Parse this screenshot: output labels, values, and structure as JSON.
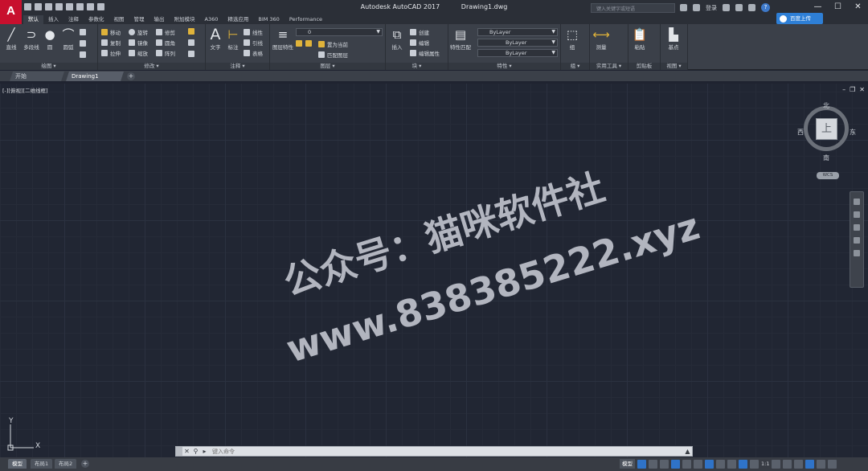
{
  "window": {
    "app_letter": "A",
    "title_app": "Autodesk AutoCAD 2017",
    "title_file": "Drawing1.dwg",
    "search_placeholder": "键入关键字或短语",
    "sign_in": "登录",
    "minimize": "—",
    "maximize": "☐",
    "close": "✕"
  },
  "cloud_button": "百度上传",
  "ribbon_tabs": [
    "默认",
    "插入",
    "注释",
    "参数化",
    "视图",
    "管理",
    "输出",
    "附加模块",
    "A360",
    "精选应用",
    "BIM 360",
    "Performance"
  ],
  "panels": {
    "draw": {
      "title": "绘图 ▾",
      "line": "直线",
      "polyline": "多段线",
      "circle": "圆",
      "arc": "圆弧"
    },
    "modify": {
      "title": "修改 ▾",
      "move": "移动",
      "rotate": "旋转",
      "trim": "修剪",
      "copy": "复制",
      "mirror": "镜像",
      "fillet": "圆角",
      "stretch": "拉伸",
      "scale": "缩放",
      "array": "阵列"
    },
    "annotation": {
      "title": "注释 ▾",
      "text": "文字",
      "dimension": "标注",
      "linear": "线性",
      "leader": "引线",
      "table": "表格"
    },
    "layers": {
      "title": "图层 ▾",
      "layer_props": "图层特性",
      "current_layer": "0",
      "make_current": "置为当前",
      "match_layer": "匹配图层"
    },
    "block": {
      "title": "块 ▾",
      "insert": "插入",
      "create": "创建",
      "edit": "编辑",
      "edit_attr": "编辑属性"
    },
    "properties": {
      "title": "特性 ▾",
      "match": "特性匹配",
      "color": "ByLayer",
      "linetype": "ByLayer",
      "lineweight": "ByLayer"
    },
    "groups": {
      "title": "组 ▾",
      "group": "组"
    },
    "utilities": {
      "title": "实用工具 ▾",
      "measure": "测量"
    },
    "clipboard": {
      "title": "剪贴板",
      "paste": "粘贴"
    },
    "view": {
      "title": "视图 ▾",
      "base": "基点"
    }
  },
  "file_tabs": [
    "开始",
    "Drawing1"
  ],
  "viewport": {
    "label": "[-][俯视][二维线框]",
    "minimize": "–",
    "restore": "❐",
    "close": "✕"
  },
  "viewcube": {
    "north": "北",
    "south": "南",
    "east": "东",
    "west": "西",
    "face": "上",
    "wcs": "WCS"
  },
  "ucs": {
    "x": "X",
    "y": "Y"
  },
  "watermark": {
    "line1": "公众号：猫咪软件社",
    "line2": "www.838385222.xyz"
  },
  "command_line": {
    "placeholder": "键入命令"
  },
  "layout_tabs": [
    "模型",
    "布局1",
    "布局2"
  ],
  "status": {
    "model": "模型",
    "scale": "1:1"
  }
}
